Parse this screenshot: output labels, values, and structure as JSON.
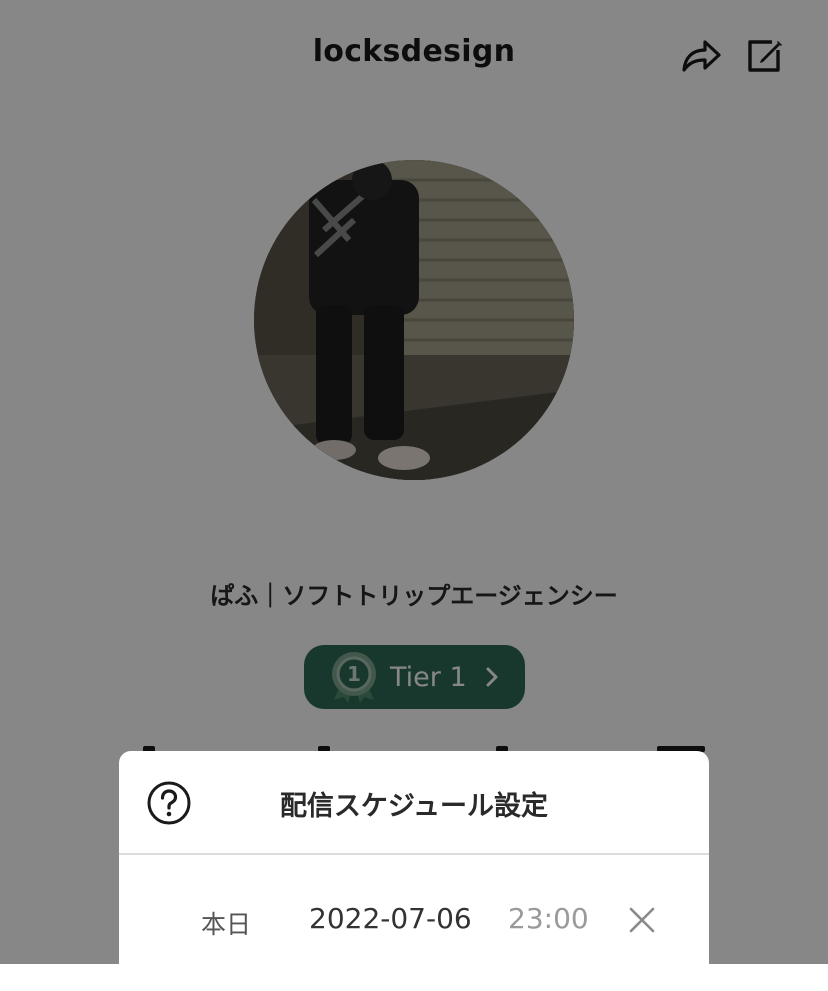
{
  "header": {
    "title": "locksdesign",
    "icons": {
      "share": "share-arrow-icon",
      "edit": "edit-icon"
    }
  },
  "profile": {
    "display_name": "ぱふ｜ソフトトリップエージェンシー",
    "tier": {
      "label": "Tier 1",
      "number": "1",
      "color": "#2f6a57"
    }
  },
  "modal": {
    "title": "配信スケジュール設定",
    "help_icon": "help-circle-icon",
    "row": {
      "label": "本日",
      "date": "2022-07-06",
      "time": "23:00",
      "clear_icon": "close-icon"
    }
  },
  "colors": {
    "overlay": "#000000",
    "accent_green": "#2f6a57"
  }
}
